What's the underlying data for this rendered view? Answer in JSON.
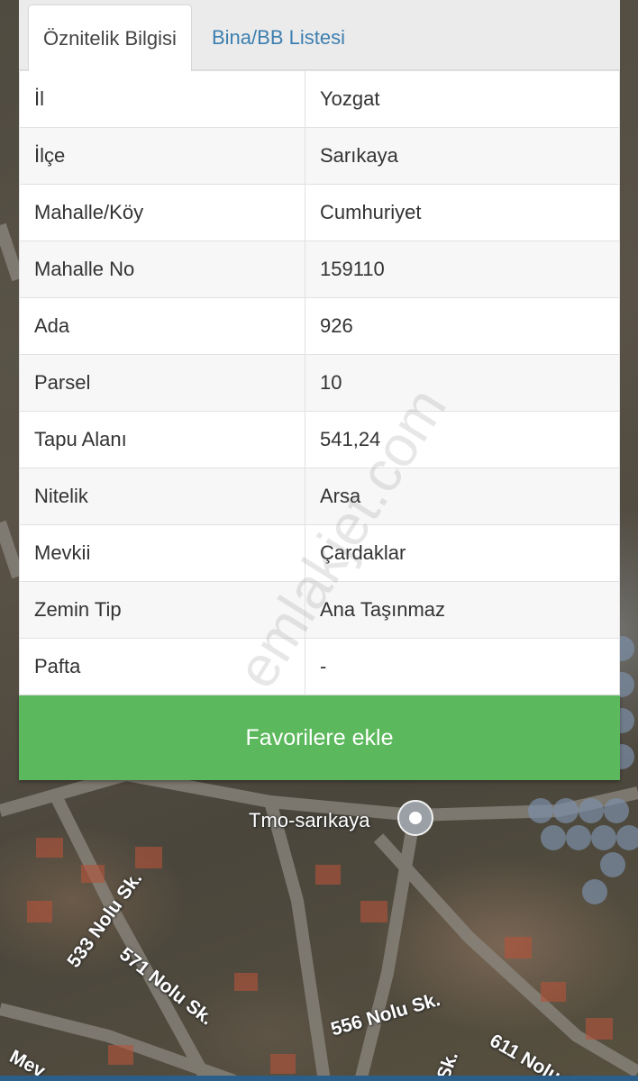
{
  "tabs": [
    {
      "label": "Öznitelik Bilgisi",
      "active": true
    },
    {
      "label": "Bina/BB Listesi",
      "active": false
    }
  ],
  "attributes": [
    {
      "key": "İl",
      "value": "Yozgat"
    },
    {
      "key": "İlçe",
      "value": "Sarıkaya"
    },
    {
      "key": "Mahalle/Köy",
      "value": "Cumhuriyet"
    },
    {
      "key": "Mahalle No",
      "value": "159110"
    },
    {
      "key": "Ada",
      "value": "926"
    },
    {
      "key": "Parsel",
      "value": "10"
    },
    {
      "key": "Tapu Alanı",
      "value": "541,24"
    },
    {
      "key": "Nitelik",
      "value": "Arsa"
    },
    {
      "key": "Mevkii",
      "value": "Çardaklar"
    },
    {
      "key": "Zemin Tip",
      "value": "Ana Taşınmaz"
    },
    {
      "key": "Pafta",
      "value": "-"
    }
  ],
  "favorite_button": {
    "label": "Favorilere ekle",
    "color": "#5cb85c"
  },
  "watermark": "emlakjet.com",
  "map": {
    "place_label": "Tmo-sarıkaya",
    "poi_icon": "map-pin-circle-icon",
    "street_labels": [
      "533 Nolu Sk.",
      "571 Nolu Sk.",
      "556 Nolu Sk.",
      "611 Nolu Sk.",
      "Sk.",
      "Mev"
    ]
  }
}
